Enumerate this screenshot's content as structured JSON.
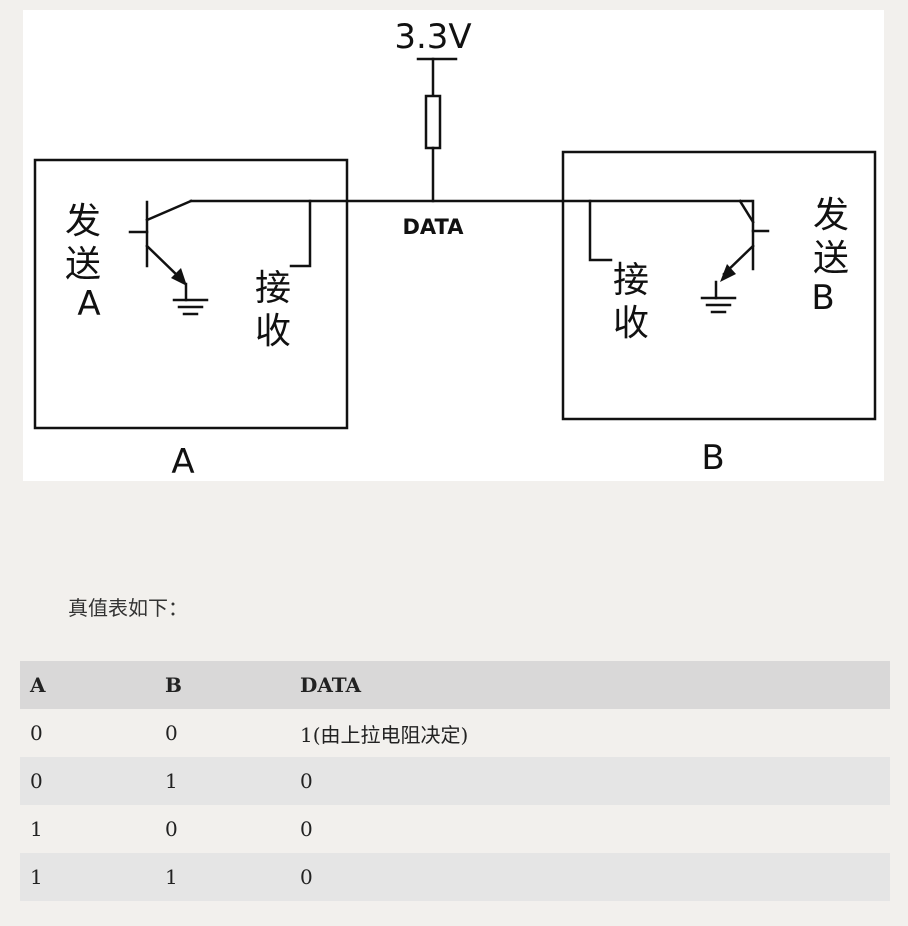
{
  "diagram": {
    "vcc_label": "3.3V",
    "data_label": "DATA",
    "left": {
      "box_label": "A",
      "send": [
        "发",
        "送",
        "A"
      ],
      "recv": [
        "接",
        "收"
      ]
    },
    "right": {
      "box_label": "B",
      "send": [
        "发",
        "送",
        "B"
      ],
      "recv": [
        "接",
        "收"
      ]
    }
  },
  "caption": "真值表如下：",
  "table": {
    "headers": [
      "A",
      "B",
      "DATA"
    ],
    "rows": [
      [
        "0",
        "0",
        "1(由上拉电阻决定)"
      ],
      [
        "0",
        "1",
        "0"
      ],
      [
        "1",
        "0",
        "0"
      ],
      [
        "1",
        "1",
        "0"
      ]
    ]
  }
}
